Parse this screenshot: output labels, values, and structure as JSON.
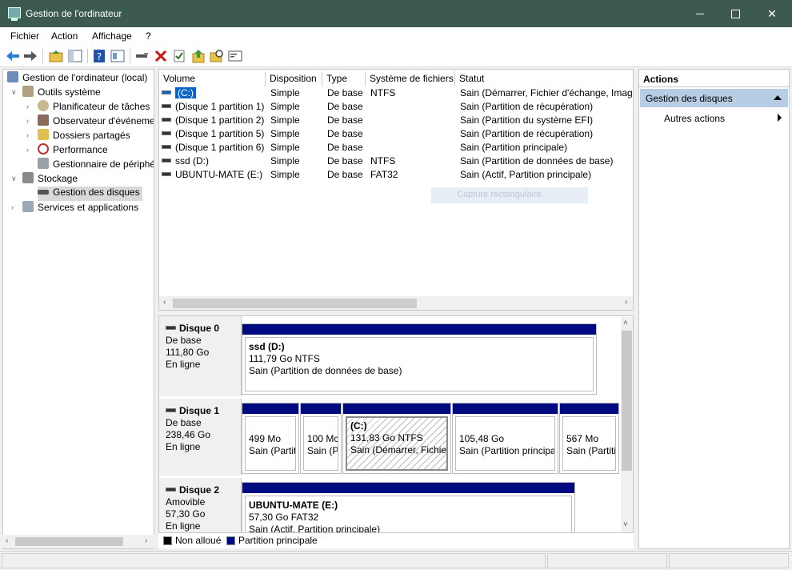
{
  "window": {
    "title": "Gestion de l'ordinateur"
  },
  "menu": [
    "Fichier",
    "Action",
    "Affichage",
    "?"
  ],
  "tree": {
    "root": "Gestion de l'ordinateur (local)",
    "system_tools": "Outils système",
    "task_scheduler": "Planificateur de tâches",
    "event_viewer": "Observateur d'événeme",
    "shared_folders": "Dossiers partagés",
    "performance": "Performance",
    "device_manager": "Gestionnaire de périphé",
    "storage": "Stockage",
    "disk_management": "Gestion des disques",
    "services": "Services et applications"
  },
  "volume_table": {
    "headers": [
      "Volume",
      "Disposition",
      "Type",
      "Système de fichiers",
      "Statut"
    ],
    "rows": [
      [
        "(C:)",
        "Simple",
        "De base",
        "NTFS",
        "Sain (Démarrer, Fichier d'échange, Image"
      ],
      [
        "(Disque 1 partition 1)",
        "Simple",
        "De base",
        "",
        "Sain (Partition de récupération)"
      ],
      [
        "(Disque 1 partition 2)",
        "Simple",
        "De base",
        "",
        "Sain (Partition du système EFI)"
      ],
      [
        "(Disque 1 partition 5)",
        "Simple",
        "De base",
        "",
        "Sain (Partition de récupération)"
      ],
      [
        "(Disque 1 partition 6)",
        "Simple",
        "De base",
        "",
        "Sain (Partition principale)"
      ],
      [
        "ssd  (D:)",
        "Simple",
        "De base",
        "NTFS",
        "Sain (Partition de données de base)"
      ],
      [
        "UBUNTU-MATE (E:)",
        "Simple",
        "De base",
        "FAT32",
        "Sain (Actif, Partition principale)"
      ]
    ],
    "ghost_tooltip": "Capture rectangulaire"
  },
  "disks": {
    "disk0": {
      "name": "Disque 0",
      "type": "De base",
      "size": "111,80 Go",
      "state": "En ligne"
    },
    "disk0_p1": {
      "title": "ssd   (D:)",
      "size": "111,79 Go NTFS",
      "status": "Sain (Partition de données de base)"
    },
    "disk1": {
      "name": "Disque 1",
      "type": "De base",
      "size": "238,46 Go",
      "state": "En ligne"
    },
    "disk1_p1": {
      "size": "499 Mo",
      "status": "Sain (Partit"
    },
    "disk1_p2": {
      "size": "100 Mc",
      "status": "Sain (P"
    },
    "disk1_p3": {
      "title": "(C:)",
      "size": "131,83 Go NTFS",
      "status": "Sain (Démarrer, Fichier"
    },
    "disk1_p4": {
      "size": "105,48 Go",
      "status": "Sain (Partition principa"
    },
    "disk1_p5": {
      "size": "567 Mo",
      "status": "Sain (Partiti"
    },
    "disk2": {
      "name": "Disque 2",
      "type": "Amovible",
      "size": "57,30 Go",
      "state": "En ligne"
    },
    "disk2_p1": {
      "title": "UBUNTU-MATE  (E:)",
      "size": "57,30 Go FAT32",
      "status": "Sain (Actif, Partition principale)"
    }
  },
  "legend": {
    "unallocated": "Non alloué",
    "primary": "Partition principale"
  },
  "actions": {
    "header": "Actions",
    "section": "Gestion des disques",
    "more": "Autres actions"
  },
  "colors": {
    "titlebar": "#3c5a50",
    "partition_bar": "#000a80",
    "selection": "#0a64c8"
  },
  "icons": [
    "back-arrow-icon",
    "forward-arrow-icon",
    "folder-up-icon",
    "show-hide-tree-icon",
    "help-icon",
    "properties-icon",
    "connect-icon",
    "delete-icon",
    "checkbox-icon",
    "export-icon",
    "search-icon",
    "console-icon"
  ]
}
